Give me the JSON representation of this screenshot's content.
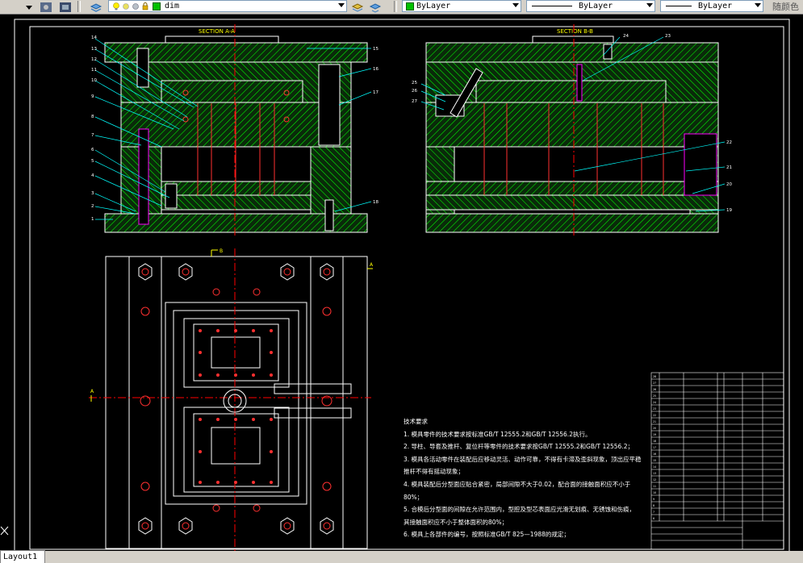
{
  "toolbar": {
    "layer_name": "dim",
    "color_combo": "ByLayer",
    "linetype_combo": "ByLayer",
    "lineweight_combo": "ByLayer",
    "plotstyle_label": "随颜色"
  },
  "drawing": {
    "section_a": "SECTION A-A",
    "section_b": "SECTION B-B",
    "view_b_label": "B",
    "view_a_label": "A",
    "callouts_left": [
      "14",
      "13",
      "12",
      "11",
      "10",
      "9",
      "8",
      "7",
      "6",
      "5",
      "4",
      "3",
      "2",
      "1",
      "15",
      "16",
      "17",
      "18"
    ],
    "callouts_right": [
      "24",
      "23",
      "25",
      "26",
      "27",
      "22",
      "21",
      "20",
      "19"
    ]
  },
  "notes": {
    "title": "技术要求",
    "items": [
      "1. 模具零件的技术要求按标准GB/T 12555.2和GB/T 12556.2执行。",
      "2. 导柱、导套及推杆、复位杆等零件的技术要求按GB/T 12555.2和GB/T 12556.2；",
      "3. 模具各活动零件在装配后应移动灵活、动作可靠，不得有卡滞及歪斜现象，顶出应平稳",
      "   推杆不得有摇动现象；",
      "4. 模具装配后分型面应贴合紧密，局部间隙不大于0.02，配合面的接触面积应不小于",
      "   80%；",
      "5. 合模后分型面的间隙在允许范围内，型腔及型芯表面应光滑无划痕、无锈蚀和伤痕，",
      "   其接触面积应不小于整体面积的80%；",
      "6. 模具上各部件的编号，按照标准GB/T 825—1988的规定；"
    ]
  },
  "layout_tab": "Layout1",
  "colors": {
    "background": "#000000",
    "hatch": "#00ff00",
    "outline": "#00ffff",
    "accent": "#ff0000",
    "text": "#ffffff",
    "toolbar": "#d4d0c8"
  }
}
